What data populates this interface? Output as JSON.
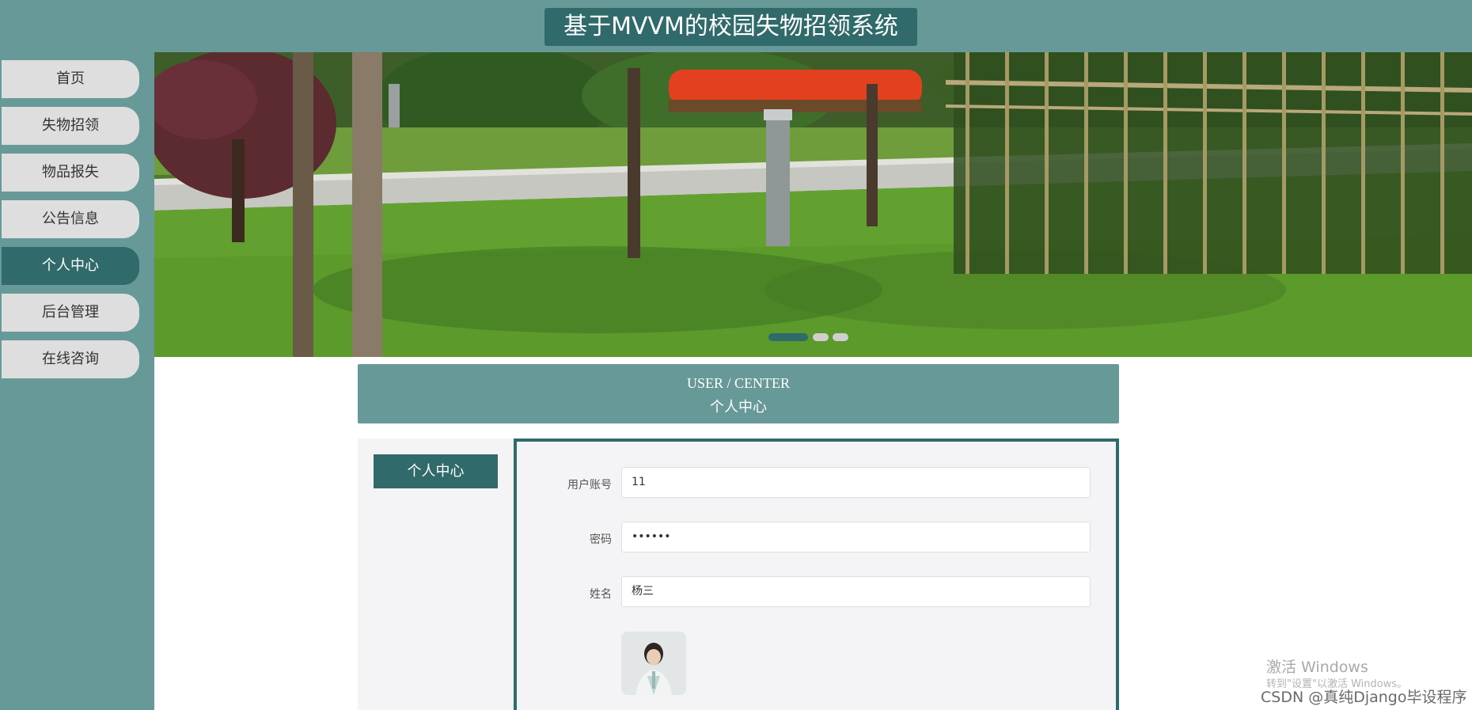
{
  "header": {
    "title": "基于MVVM的校园失物招领系统"
  },
  "sidebar": {
    "items": [
      {
        "label": "首页",
        "active": false
      },
      {
        "label": "失物招领",
        "active": false
      },
      {
        "label": "物品报失",
        "active": false
      },
      {
        "label": "公告信息",
        "active": false
      },
      {
        "label": "个人中心",
        "active": true
      },
      {
        "label": "后台管理",
        "active": false
      },
      {
        "label": "在线咨询",
        "active": false
      }
    ]
  },
  "banner": {
    "slide_count": 3,
    "active_slide": 1
  },
  "section": {
    "title_en": "USER / CENTER",
    "title_cn": "个人中心"
  },
  "left_menu": {
    "items": [
      {
        "label": "个人中心",
        "active": true
      }
    ]
  },
  "form": {
    "fields": [
      {
        "label": "用户账号",
        "value": "11"
      },
      {
        "label": "密码",
        "value": "••••••"
      },
      {
        "label": "姓名",
        "value": "杨三"
      }
    ]
  },
  "watermarks": {
    "windows_line1": "激活 Windows",
    "windows_line2": "转到\"设置\"以激活 Windows。",
    "csdn": "CSDN @真纯Django毕设程序"
  },
  "colors": {
    "primary": "#679999",
    "dark": "#316a6a",
    "panel_bg": "#f4f4f6",
    "nav_bg": "#dedede"
  }
}
